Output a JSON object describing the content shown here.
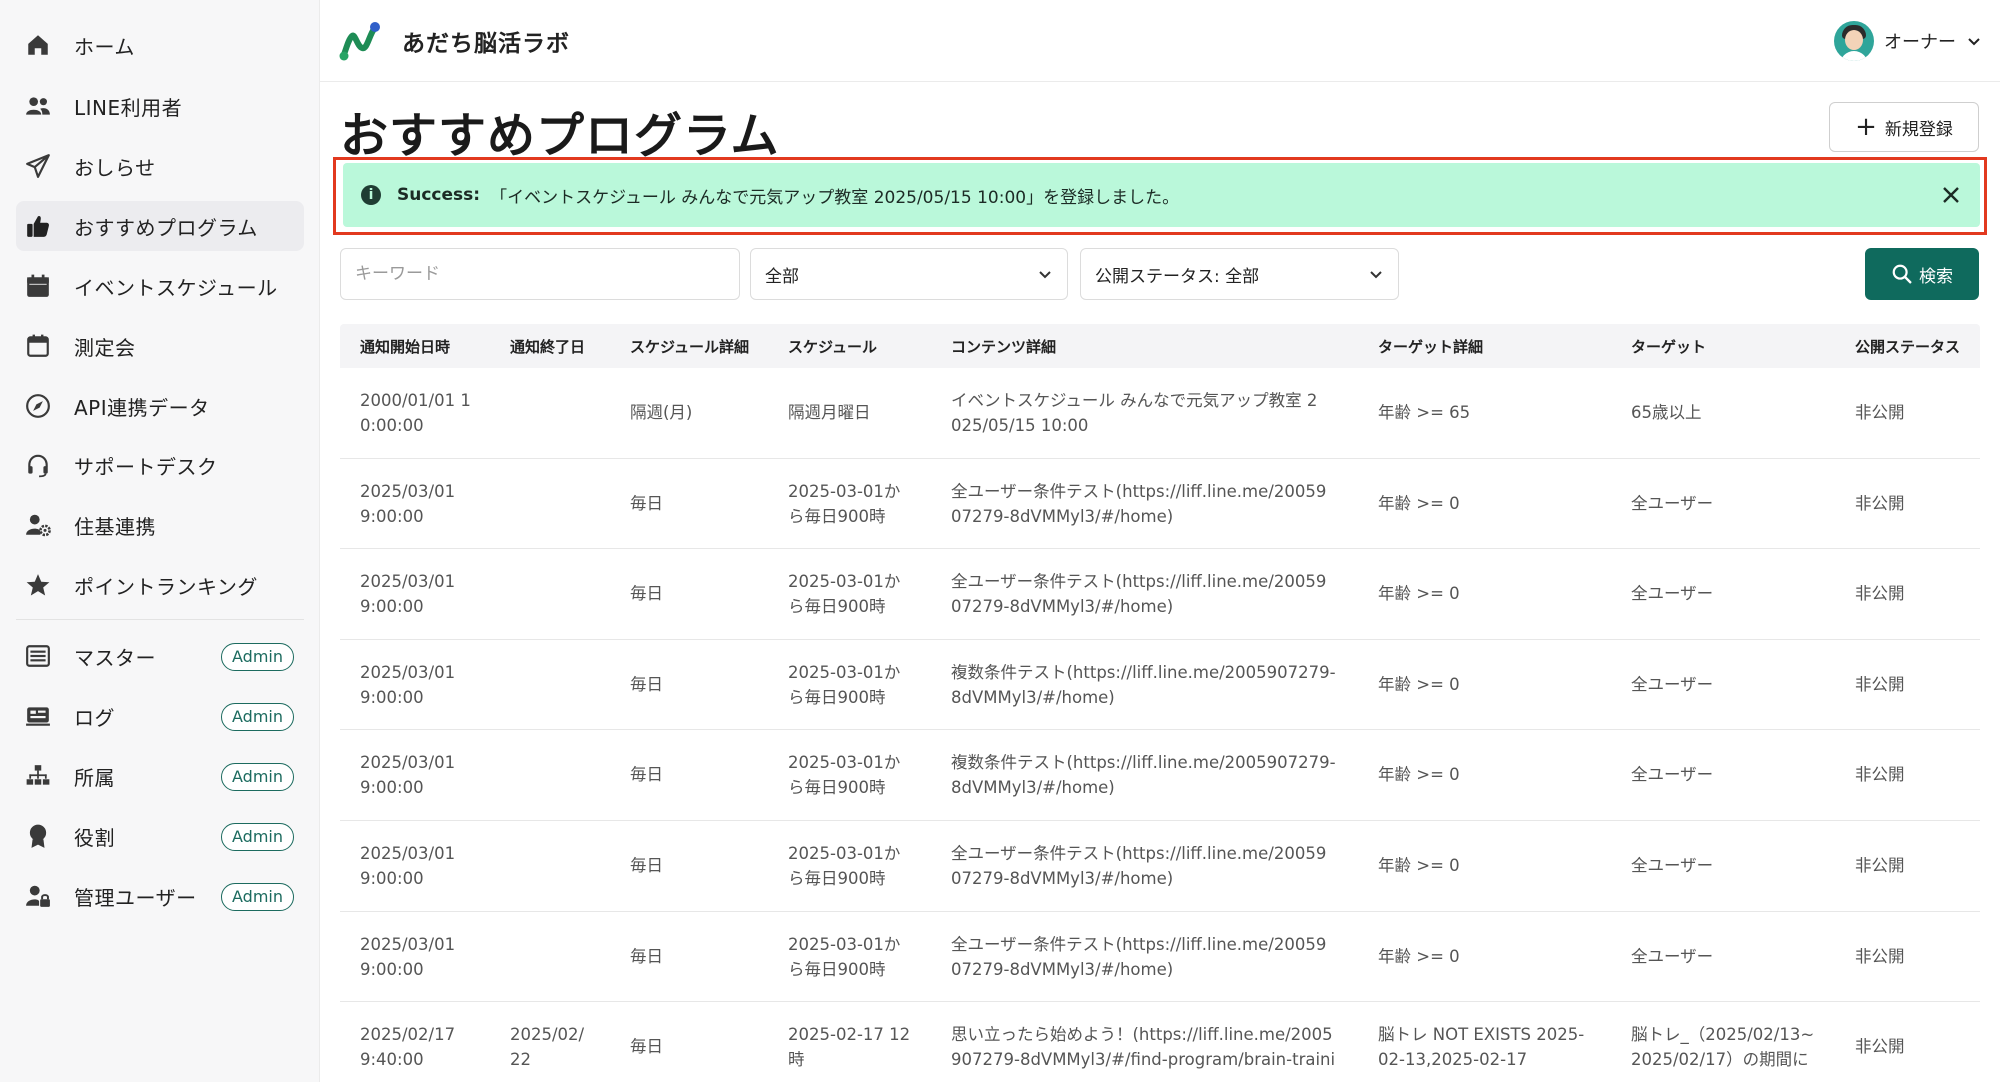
{
  "app": {
    "brand_name": "あだち脳活ラボ",
    "user_name": "オーナー"
  },
  "sidebar": {
    "items": [
      {
        "label": "ホーム",
        "icon": "home-icon"
      },
      {
        "label": "LINE利用者",
        "icon": "users-icon"
      },
      {
        "label": "おしらせ",
        "icon": "paper-plane-icon"
      },
      {
        "label": "おすすめプログラム",
        "icon": "thumbs-up-icon",
        "active": true
      },
      {
        "label": "イベントスケジュール",
        "icon": "calendar-icon"
      },
      {
        "label": "測定会",
        "icon": "calendar-blank-icon"
      },
      {
        "label": "API連携データ",
        "icon": "api-compass-icon"
      },
      {
        "label": "サポートデスク",
        "icon": "headset-icon"
      },
      {
        "label": "住基連携",
        "icon": "user-gear-icon"
      },
      {
        "label": "ポイントランキング",
        "icon": "star-icon"
      }
    ],
    "admin_items": [
      {
        "label": "マスター",
        "badge": "Admin",
        "icon": "list-icon"
      },
      {
        "label": "ログ",
        "badge": "Admin",
        "icon": "log-icon"
      },
      {
        "label": "所属",
        "badge": "Admin",
        "icon": "org-chart-icon"
      },
      {
        "label": "役割",
        "badge": "Admin",
        "icon": "award-icon"
      },
      {
        "label": "管理ユーザー",
        "badge": "Admin",
        "icon": "user-lock-icon"
      }
    ]
  },
  "main": {
    "title": "おすすめプログラム",
    "new_button_label": "新規登録",
    "alert": {
      "title": "Success:",
      "message": "「イベントスケジュール みんなで元気アップ教室 2025/05/15 10:00」を登録しました。"
    },
    "filters": {
      "keyword_placeholder": "キーワード",
      "select1_value": "全部",
      "select2_value": "公開ステータス: 全部",
      "search_label": "検索"
    },
    "table": {
      "columns": [
        "通知開始日時",
        "通知終了日",
        "スケジュール詳細",
        "スケジュール",
        "コンテンツ詳細",
        "ターゲット詳細",
        "ターゲット",
        "公開ステータス"
      ],
      "rows": [
        {
          "start": [
            "2000/01/01 1",
            "0:00:00"
          ],
          "end": [],
          "sched_detail": "隔週(月)",
          "sched": [
            "隔週月曜日"
          ],
          "content": [
            "イベントスケジュール みんなで元気アップ教室 2",
            "025/05/15 10:00"
          ],
          "target_detail": [
            "年齢 >= 65"
          ],
          "target": [
            "65歳以上"
          ],
          "status": "非公開"
        },
        {
          "start": [
            "2025/03/01",
            "9:00:00"
          ],
          "end": [],
          "sched_detail": "毎日",
          "sched": [
            "2025-03-01か",
            "ら毎日900時"
          ],
          "content": [
            "全ユーザー条件テスト(https://liff.line.me/20059",
            "07279-8dVMMyl3/#/home)"
          ],
          "target_detail": [
            "年齢 >= 0"
          ],
          "target": [
            "全ユーザー"
          ],
          "status": "非公開"
        },
        {
          "start": [
            "2025/03/01",
            "9:00:00"
          ],
          "end": [],
          "sched_detail": "毎日",
          "sched": [
            "2025-03-01か",
            "ら毎日900時"
          ],
          "content": [
            "全ユーザー条件テスト(https://liff.line.me/20059",
            "07279-8dVMMyl3/#/home)"
          ],
          "target_detail": [
            "年齢 >= 0"
          ],
          "target": [
            "全ユーザー"
          ],
          "status": "非公開"
        },
        {
          "start": [
            "2025/03/01",
            "9:00:00"
          ],
          "end": [],
          "sched_detail": "毎日",
          "sched": [
            "2025-03-01か",
            "ら毎日900時"
          ],
          "content": [
            "複数条件テスト(https://liff.line.me/2005907279-",
            "8dVMMyl3/#/home)"
          ],
          "target_detail": [
            "年齢 >= 0"
          ],
          "target": [
            "全ユーザー"
          ],
          "status": "非公開"
        },
        {
          "start": [
            "2025/03/01",
            "9:00:00"
          ],
          "end": [],
          "sched_detail": "毎日",
          "sched": [
            "2025-03-01か",
            "ら毎日900時"
          ],
          "content": [
            "複数条件テスト(https://liff.line.me/2005907279-",
            "8dVMMyl3/#/home)"
          ],
          "target_detail": [
            "年齢 >= 0"
          ],
          "target": [
            "全ユーザー"
          ],
          "status": "非公開"
        },
        {
          "start": [
            "2025/03/01",
            "9:00:00"
          ],
          "end": [],
          "sched_detail": "毎日",
          "sched": [
            "2025-03-01か",
            "ら毎日900時"
          ],
          "content": [
            "全ユーザー条件テスト(https://liff.line.me/20059",
            "07279-8dVMMyl3/#/home)"
          ],
          "target_detail": [
            "年齢 >= 0"
          ],
          "target": [
            "全ユーザー"
          ],
          "status": "非公開"
        },
        {
          "start": [
            "2025/03/01",
            "9:00:00"
          ],
          "end": [],
          "sched_detail": "毎日",
          "sched": [
            "2025-03-01か",
            "ら毎日900時"
          ],
          "content": [
            "全ユーザー条件テスト(https://liff.line.me/20059",
            "07279-8dVMMyl3/#/home)"
          ],
          "target_detail": [
            "年齢 >= 0"
          ],
          "target": [
            "全ユーザー"
          ],
          "status": "非公開"
        },
        {
          "start": [
            "2025/02/17",
            "9:40:00"
          ],
          "end": [
            "2025/02/",
            "22"
          ],
          "sched_detail": "毎日",
          "sched": [
            "2025-02-17 12",
            "時"
          ],
          "content": [
            "思い立ったら始めよう！(https://liff.line.me/2005",
            "907279-8dVMMyl3/#/find-program/brain-traini"
          ],
          "target_detail": [
            "脳トレ NOT EXISTS 2025-",
            "02-13,2025-02-17"
          ],
          "target": [
            "脳トレ_（2025/02/13~",
            "2025/02/17）の期間に"
          ],
          "status": "非公開"
        }
      ]
    }
  },
  "colors": {
    "accent": "#0f6a5d",
    "alert_bg": "#baf8da",
    "alert_border": "#e2391f"
  }
}
